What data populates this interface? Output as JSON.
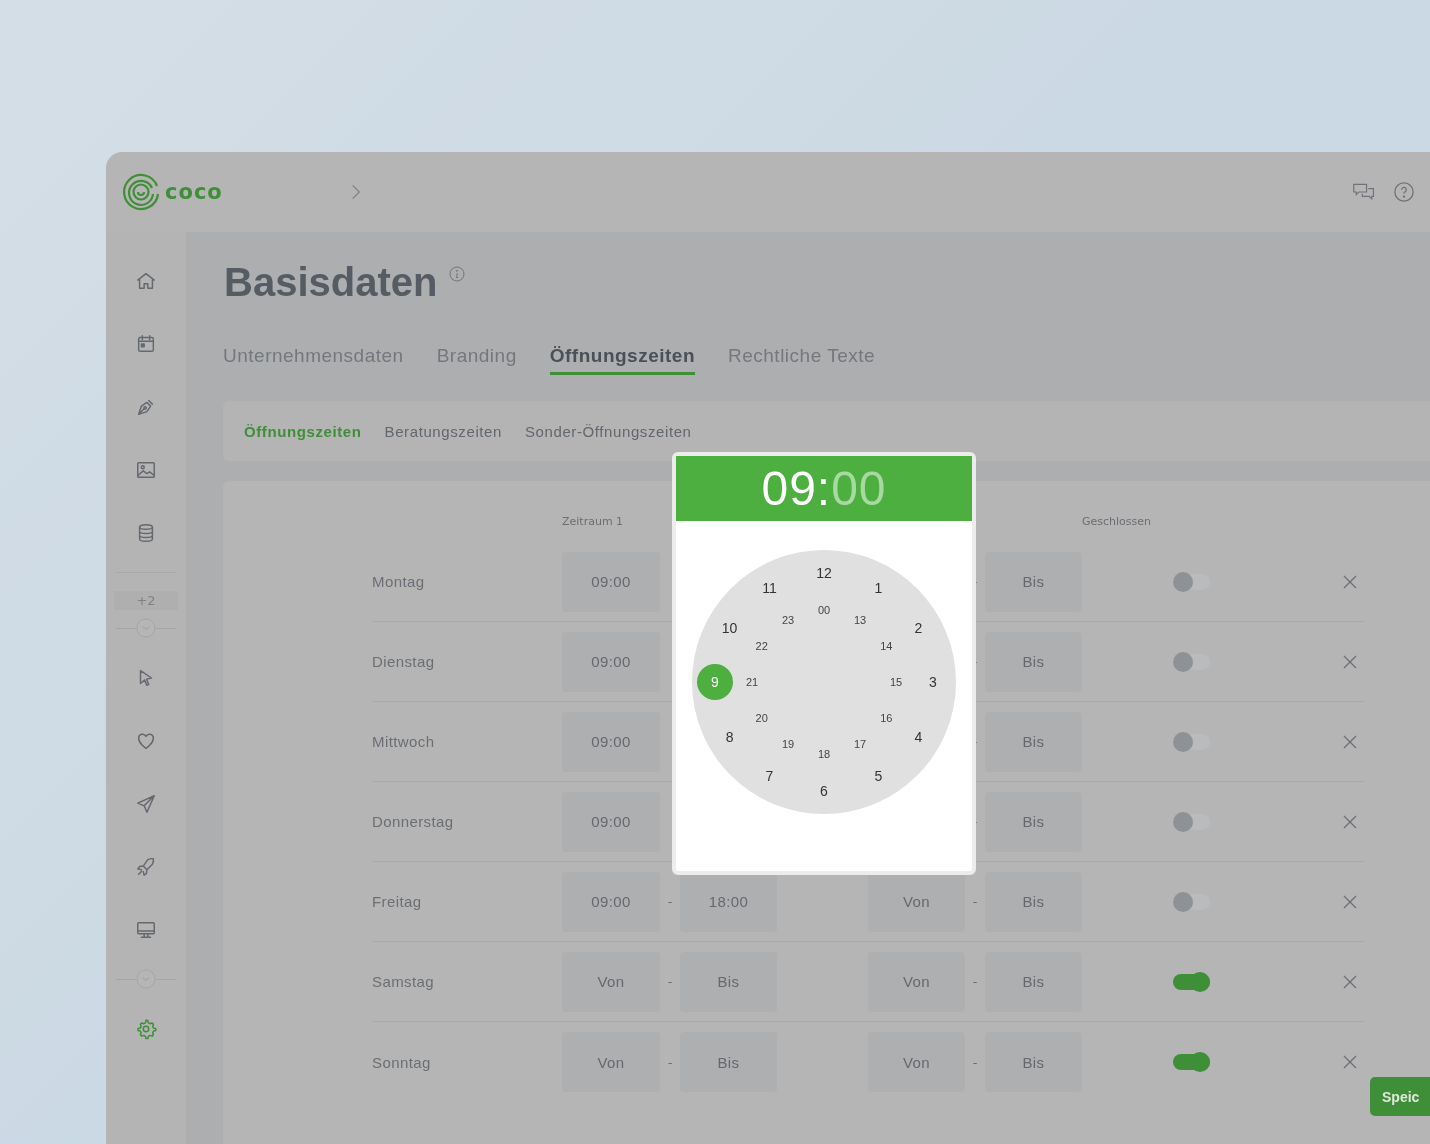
{
  "logo": {
    "text": "coco"
  },
  "sidebar": {
    "items_top": [
      {
        "selected": false
      },
      {
        "selected": false
      },
      {
        "selected": false
      },
      {
        "selected": false
      },
      {
        "selected": false
      }
    ],
    "more_badge": "+2",
    "items_middle": [
      {
        "selected": false
      },
      {
        "selected": false
      },
      {
        "selected": false
      },
      {
        "selected": false
      },
      {
        "selected": false
      }
    ],
    "items_bottom": [
      {
        "selected": true
      }
    ]
  },
  "page": {
    "title": "Basisdaten"
  },
  "tabs": [
    {
      "label": "Unternehmensdaten",
      "selected": false
    },
    {
      "label": "Branding",
      "selected": false
    },
    {
      "label": "Öffnungszeiten",
      "selected": true
    },
    {
      "label": "Rechtliche Texte",
      "selected": false
    }
  ],
  "subtabs": [
    {
      "label": "Öffnungszeiten",
      "selected": true
    },
    {
      "label": "Beratungszeiten",
      "selected": false
    },
    {
      "label": "Sonder-Öffnungszeiten",
      "selected": false
    }
  ],
  "table": {
    "columns": {
      "period_1": "Zeitraum 1",
      "closed": "Geschlossen"
    },
    "rows": [
      {
        "day": "Montag",
        "period_1": {
          "from": "09:00"
        },
        "period_2": {
          "separator": "-",
          "to": "Bis"
        },
        "closed": false
      },
      {
        "day": "Dienstag",
        "period_1": {
          "from": "09:00"
        },
        "period_2": {
          "separator": "-",
          "to": "Bis"
        },
        "closed": false
      },
      {
        "day": "Mittwoch",
        "period_1": {
          "from": "09:00"
        },
        "period_2": {
          "separator": "-",
          "to": "Bis"
        },
        "closed": false
      },
      {
        "day": "Donnerstag",
        "period_1": {
          "from": "09:00"
        },
        "period_2": {
          "separator": "-",
          "to": "Bis"
        },
        "closed": false
      },
      {
        "day": "Freitag",
        "period_1": {
          "from": "09:00",
          "separator": "-",
          "to": "18:00"
        },
        "period_2": {
          "from": "Von",
          "separator": "-",
          "to": "Bis"
        },
        "closed": false
      },
      {
        "day": "Samstag",
        "period_1": {
          "from": "Von",
          "separator": "-",
          "to": "Bis"
        },
        "period_2": {
          "from": "Von",
          "separator": "-",
          "to": "Bis"
        },
        "closed": true
      },
      {
        "day": "Sonntag",
        "period_1": {
          "from": "Von",
          "separator": "-",
          "to": "Bis"
        },
        "period_2": {
          "from": "Von",
          "separator": "-",
          "to": "Bis"
        },
        "closed": true
      }
    ]
  },
  "time_picker": {
    "hours": "09",
    "separator": ":",
    "minutes": "00",
    "hours_active": true,
    "outer": [
      {
        "label": "12",
        "selected": false
      },
      {
        "label": "1",
        "selected": false
      },
      {
        "label": "2",
        "selected": false
      },
      {
        "label": "3",
        "selected": false
      },
      {
        "label": "4",
        "selected": false
      },
      {
        "label": "5",
        "selected": false
      },
      {
        "label": "6",
        "selected": false
      },
      {
        "label": "7",
        "selected": false
      },
      {
        "label": "8",
        "selected": false
      },
      {
        "label": "9",
        "selected": true
      },
      {
        "label": "10",
        "selected": false
      },
      {
        "label": "11",
        "selected": false
      }
    ],
    "inner": [
      {
        "label": "00",
        "selected": false
      },
      {
        "label": "13",
        "selected": false
      },
      {
        "label": "14",
        "selected": false
      },
      {
        "label": "15",
        "selected": false
      },
      {
        "label": "16",
        "selected": false
      },
      {
        "label": "17",
        "selected": false
      },
      {
        "label": "18",
        "selected": false
      },
      {
        "label": "19",
        "selected": false
      },
      {
        "label": "20",
        "selected": false
      },
      {
        "label": "21",
        "selected": false
      },
      {
        "label": "22",
        "selected": false
      },
      {
        "label": "23",
        "selected": false
      }
    ]
  },
  "save_button": {
    "label": "Speic"
  }
}
